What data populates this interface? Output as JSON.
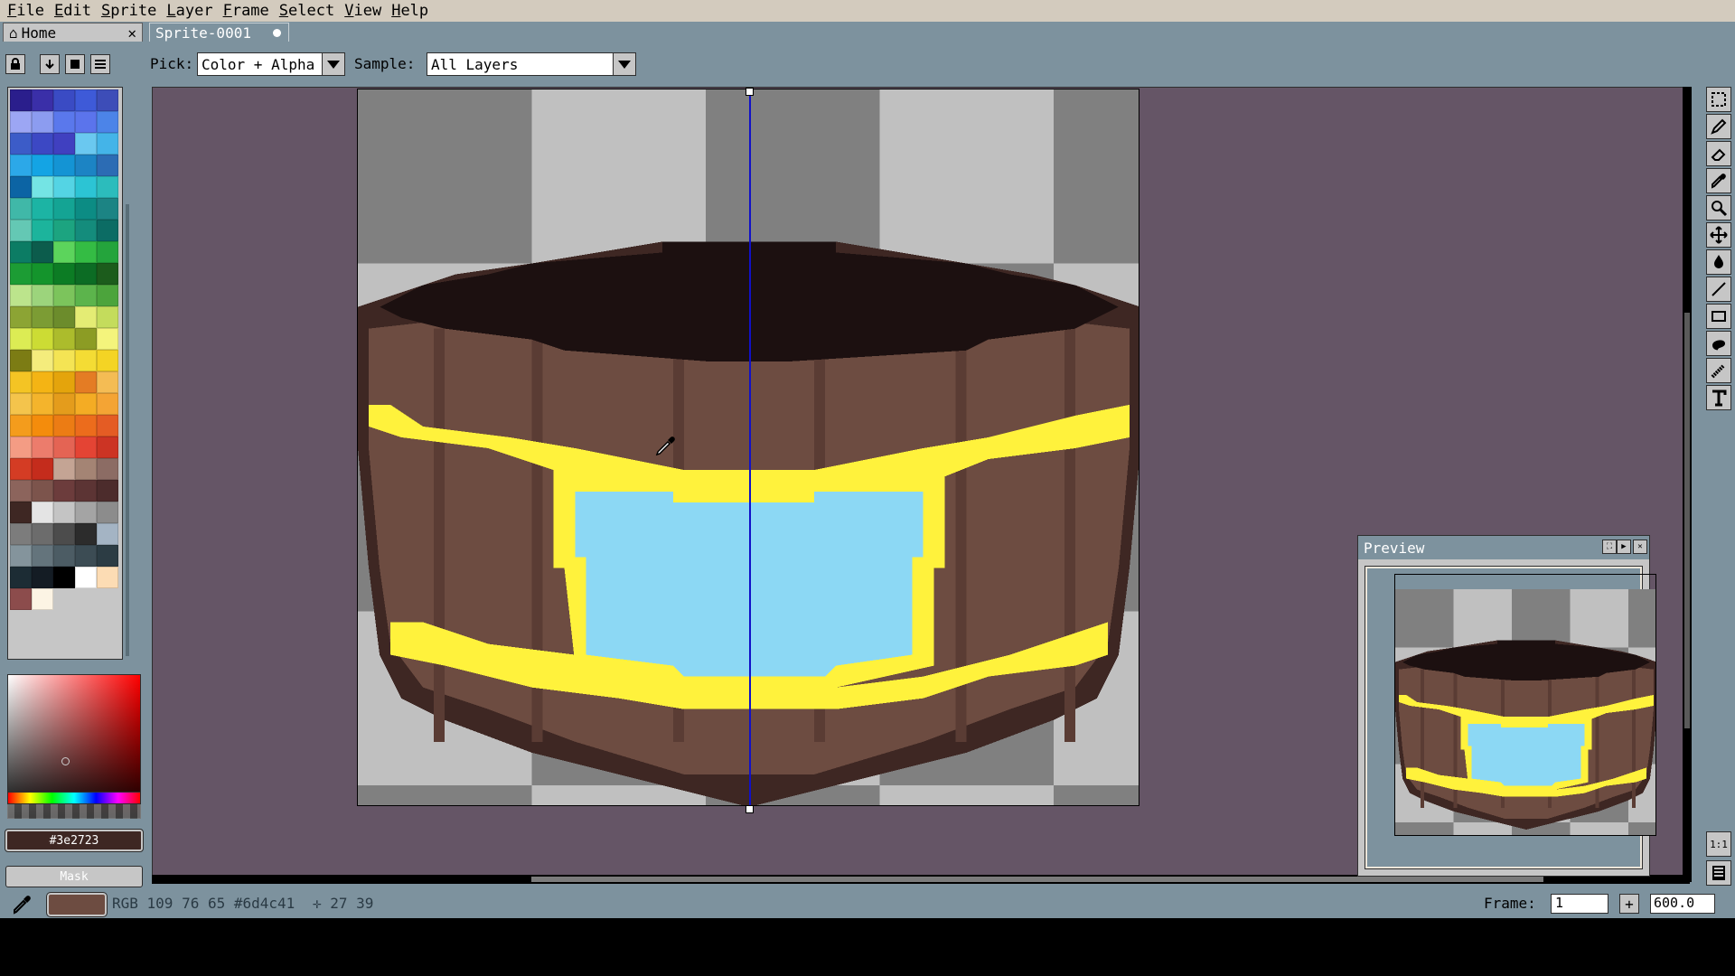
{
  "menu": [
    "File",
    "Edit",
    "Sprite",
    "Layer",
    "Frame",
    "Select",
    "View",
    "Help"
  ],
  "tabs": {
    "home_label": "Home",
    "home_close": "✕",
    "sprite_label": "Sprite-0001"
  },
  "context_bar": {
    "pick_label": "Pick:",
    "pick_value": "Color + Alpha",
    "sample_label": "Sample:",
    "sample_value": "All Layers"
  },
  "palette_colors": [
    "#2a1e8c",
    "#3a2fa8",
    "#3a4bc4",
    "#3e5ad8",
    "#3d4db8",
    "#9ca6f4",
    "#8c9cf0",
    "#5a78ec",
    "#5b74ec",
    "#4c84e8",
    "#3c5cc8",
    "#3c48c4",
    "#4040c0",
    "#6ac8f0",
    "#44b4e8",
    "#2ca8e8",
    "#14a4e4",
    "#1494d4",
    "#1c84c4",
    "#2c6cb4",
    "#0c64a4",
    "#74e4e4",
    "#54d4e4",
    "#2cc4d4",
    "#2cbcbc",
    "#40b8a8",
    "#1cb4a4",
    "#14a494",
    "#0c8c84",
    "#1c8484",
    "#64c8b4",
    "#1cb49c",
    "#1ca480",
    "#148c7c",
    "#0c6c64",
    "#0c7c64",
    "#0c5c4c",
    "#5cd45c",
    "#34bc44",
    "#24a43c",
    "#1c9c34",
    "#14942c",
    "#0c7c24",
    "#0c6c24",
    "#1c5c1c",
    "#bce48c",
    "#9cd47c",
    "#7cc45c",
    "#5cb44c",
    "#4ca43c",
    "#8ca434",
    "#7c9c34",
    "#6c8c2c",
    "#e4ec74",
    "#c4dc5c",
    "#dcec54",
    "#ccdc34",
    "#acbc2c",
    "#8c9c24",
    "#f4f47c",
    "#7c7c14",
    "#f4ec7c",
    "#f4e454",
    "#f4dc34",
    "#f4d424",
    "#f4c424",
    "#f4b414",
    "#e4a40c",
    "#e47c24",
    "#f4bc54",
    "#f4c44c",
    "#f4b42c",
    "#e49c1c",
    "#f4ac24",
    "#f4a434",
    "#f49c1c",
    "#f48c0c",
    "#ec7c14",
    "#ec6c1c",
    "#e45c24",
    "#f49c84",
    "#ec7c6c",
    "#e46454",
    "#e44434",
    "#cc3424",
    "#d43c24",
    "#c42c1c",
    "#c4a494",
    "#a48474",
    "#8c6c64",
    "#8c645c",
    "#7c544c",
    "#6c3c3c",
    "#5c3434",
    "#4c2c2c",
    "#3e2723",
    "#e4e4e4",
    "#c4c4c4",
    "#a4a4a4",
    "#8c8c8c",
    "#7c7c7c",
    "#6c6c6c",
    "#4c4c4c",
    "#2c2c2c",
    "#a4b4c4",
    "#84949c",
    "#64747c",
    "#4c5c64",
    "#3c4c54",
    "#2c3c44",
    "#1c2c34",
    "#141c24",
    "#000000",
    "#ffffff",
    "#fcdcb4",
    "#8c4c4c",
    "#fcf4e4"
  ],
  "current_hex": "#3e2723",
  "mask_label": "Mask",
  "status": {
    "rgb_text": "RGB 109 76 65 #6d4c41",
    "pos_text": "✛ 27 39",
    "frame_label": "Frame:",
    "frame_value": "1",
    "frame_plus": "+",
    "zoom_value": "600.0"
  },
  "preview": {
    "title": "Preview"
  },
  "fg_color": "#6d4c41",
  "sprite_colors": {
    "outline": "#3e2723",
    "wood": "#6d4c41",
    "wood_dark": "#5a3c34",
    "inside": "#1c1010",
    "gold": "#fff23c",
    "water": "#8cd8f4",
    "checker_dark": "#808080",
    "checker_light": "#c0c0c0"
  },
  "tools": [
    "marquee-icon",
    "pencil-icon",
    "eraser-icon",
    "eyedropper-icon",
    "zoom-icon",
    "move-icon",
    "paint-bucket-icon",
    "line-icon",
    "rectangle-icon",
    "contour-icon",
    "blur-icon",
    "text-icon"
  ]
}
